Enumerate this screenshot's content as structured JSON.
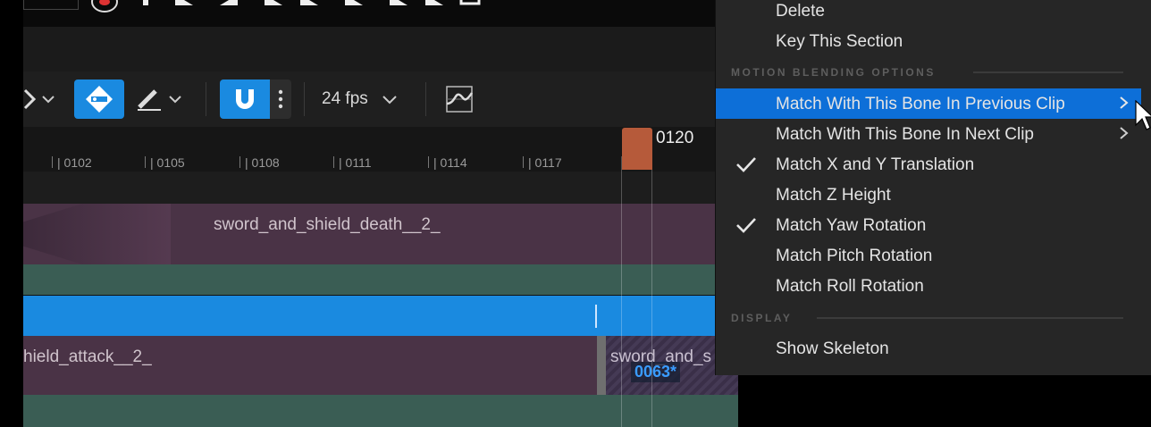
{
  "toolbar": {
    "fps_label": "24 fps"
  },
  "ruler": {
    "ticks": [
      "| 0102",
      "| 0105",
      "| 0108",
      "| 0111",
      "| 0114",
      "| 0117"
    ],
    "current_frame": "0120"
  },
  "tracks": {
    "death_clip": "sword_and_shield_death__2_",
    "attack_clip": "hield_attack__2_",
    "next_clip": "sword_and_s",
    "frame_badge": "0063*"
  },
  "menu": {
    "delete": "Delete",
    "key_section": "Key This Section",
    "motion_header": "MOTION BLENDING OPTIONS",
    "prev_clip": "Match With This Bone In Previous Clip",
    "next_clip": "Match With This Bone In Next Clip",
    "xy": "Match X and Y Translation",
    "z": "Match Z Height",
    "yaw": "Match Yaw Rotation",
    "pitch": "Match Pitch Rotation",
    "roll": "Match Roll Rotation",
    "display_header": "DISPLAY",
    "show_skeleton": "Show Skeleton"
  },
  "colors": {
    "highlight": "#0d6fd8",
    "accent_blue": "#1a8ae0",
    "clip_purple": "#4a3346",
    "track_green": "#3a5d54",
    "playhead": "#b65a3a"
  }
}
